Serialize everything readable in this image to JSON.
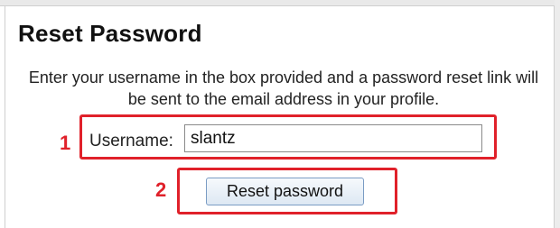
{
  "page": {
    "title": "Reset Password",
    "description": "Enter your username in the box provided and a password reset link will be sent to the email address in your profile."
  },
  "form": {
    "username_label": "Username:",
    "username_value": "slantz",
    "submit_label": "Reset password"
  },
  "annotations": {
    "step1": "1",
    "step2": "2",
    "highlight_color": "#e0212a"
  }
}
